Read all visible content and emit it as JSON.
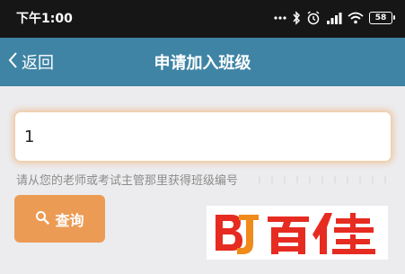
{
  "status_bar": {
    "time": "下午1:00",
    "battery": "58",
    "icons": [
      "dots-icon",
      "bluetooth-icon",
      "alarm-icon",
      "signal-icon",
      "wifi-icon",
      "battery-icon"
    ]
  },
  "nav": {
    "back_label": "返回",
    "title": "申请加入班级",
    "background": "#3f84a5"
  },
  "form": {
    "class_code_value": "1",
    "hint": "请从您的老师或考试主管那里获得班级编号",
    "search_label": "查询",
    "accent": "#ec9b55"
  },
  "watermark": {
    "text": "百佳"
  }
}
